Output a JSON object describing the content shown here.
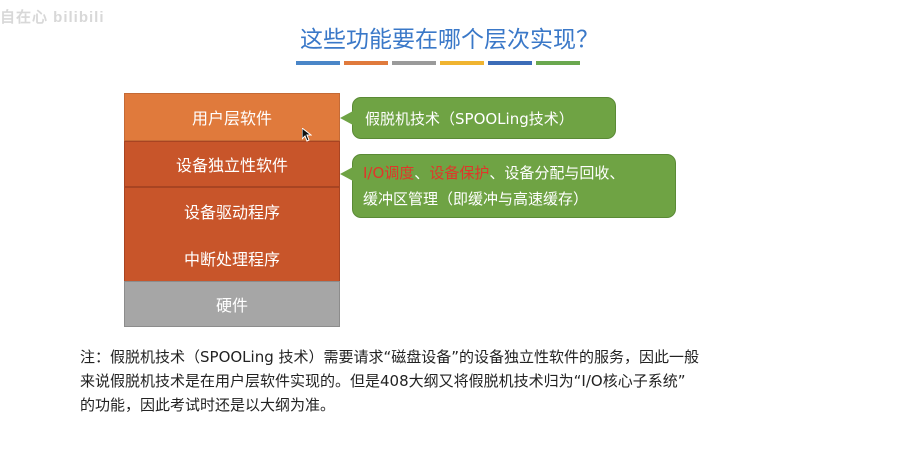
{
  "watermark": "自在心 bilibili",
  "title": "这些功能要在哪个层次实现？",
  "color_bars": [
    "#4a86c8",
    "#e07a3c",
    "#9a9a9a",
    "#f0b430",
    "#3c6cb8",
    "#6aa84f"
  ],
  "layers": [
    {
      "label": "用户层软件",
      "color": "#e07a3c"
    },
    {
      "label": "设备独立性软件",
      "color": "#c8552a"
    },
    {
      "label": "设备驱动程序",
      "color": "#c8552a"
    },
    {
      "label": "中断处理程序",
      "color": "#c8552a"
    },
    {
      "label": "硬件",
      "color": "#a6a6a6"
    }
  ],
  "callouts": {
    "spooling": "假脱机技术（SPOOLing技术）",
    "io_line1_red1": "I/O调度",
    "io_line1_sep1": "、",
    "io_line1_red2": "设备保护",
    "io_line1_rest": "、设备分配与回收、",
    "io_line2": "缓冲区管理（即缓冲与高速缓存）"
  },
  "note": {
    "line1": "注：假脱机技术（SPOOLing 技术）需要请求“磁盘设备”的设备独立性软件的服务，因此一般",
    "line2": "来说假脱机技术是在用户层软件实现的。但是408大纲又将假脱机技术归为“I/O核心子系统”",
    "line3": "的功能，因此考试时还是以大纲为准。"
  }
}
